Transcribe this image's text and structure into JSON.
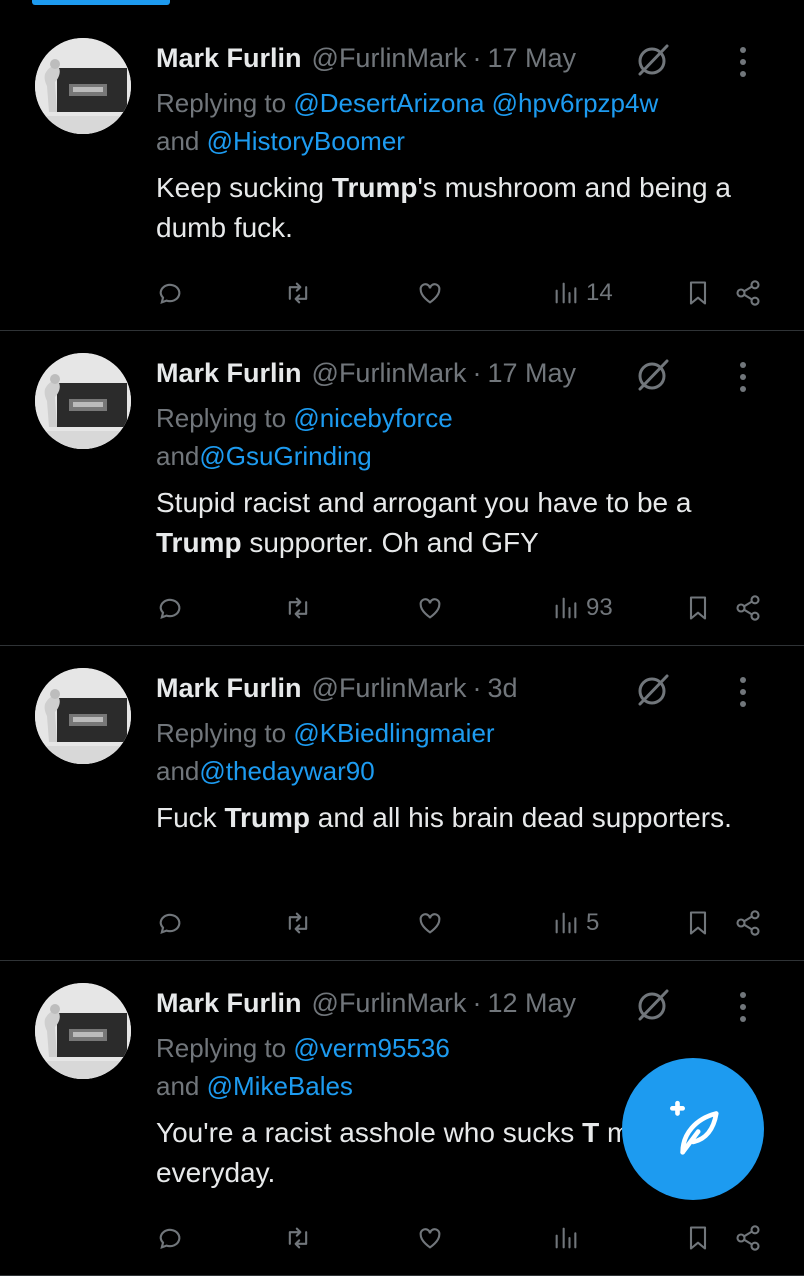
{
  "tweets": [
    {
      "name": "Mark Furlin",
      "handle": "@FurlinMark",
      "time": "17 May",
      "replying_prefix": "Replying to ",
      "replying_line1": "@DesertArizona @hpv6rpzp4w",
      "replying_and": "and ",
      "replying_line2": "@HistoryBoomer",
      "text_parts": [
        "Keep sucking ",
        "Trump",
        "'s mushroom and being a dumb fuck."
      ],
      "views": "14"
    },
    {
      "name": "Mark Furlin",
      "handle": "@FurlinMark",
      "time": "17 May",
      "replying_prefix": "Replying to ",
      "replying_line1": "@nicebyforce",
      "replying_and": " and",
      "replying_line2": "@GsuGrinding",
      "text_parts": [
        "Stupid racist and arrogant you have to be a ",
        "Trump",
        " supporter. Oh and GFY"
      ],
      "views": "93"
    },
    {
      "name": "Mark Furlin",
      "handle": "@FurlinMark",
      "time": "3d",
      "replying_prefix": "Replying to ",
      "replying_line1": "@KBiedlingmaier",
      "replying_and": " and",
      "replying_line2": "@thedaywar90",
      "text_parts": [
        "Fuck ",
        "Trump",
        " and all his brain dead supporters."
      ],
      "views": "5"
    },
    {
      "name": "Mark Furlin",
      "handle": "@FurlinMark",
      "time": "12 May",
      "replying_prefix": "Replying to ",
      "replying_line1": "@verm95536",
      "replying_and": " and ",
      "replying_line2": "@MikeBales",
      "text_parts": [
        "You're a racist asshole who sucks ",
        "T",
        " mushroom everyday."
      ],
      "views": ""
    }
  ],
  "dot": "·",
  "icons": {
    "reply": "reply-icon",
    "retweet": "retweet-icon",
    "like": "like-icon",
    "views": "views-icon",
    "bookmark": "bookmark-icon",
    "share": "share-icon",
    "grok": "grok-icon",
    "more": "more-icon",
    "compose": "compose-icon"
  },
  "colors": {
    "background": "#000000",
    "text": "#e7e9ea",
    "muted": "#71767b",
    "accent": "#1d9bf0",
    "divider": "#2f3336"
  }
}
